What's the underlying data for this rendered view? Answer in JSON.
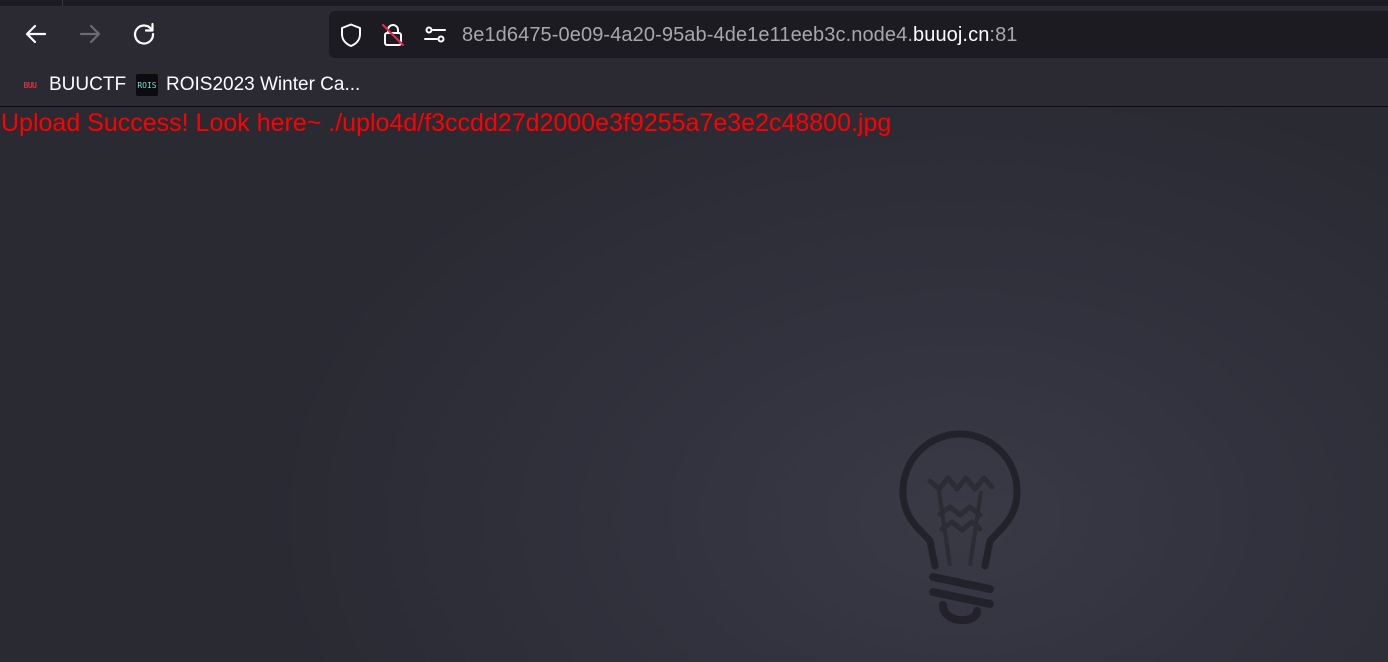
{
  "browser": {
    "toolbar": {
      "back_icon": "arrow-left-icon",
      "forward_icon": "arrow-right-icon",
      "reload_icon": "reload-icon"
    },
    "urlbar": {
      "url_prefix": "8e1d6475-0e09-4a20-95ab-4de1e11eeb3c.node4.",
      "url_domain": "buuoj.cn",
      "url_suffix": ":81",
      "icons": [
        "shield-icon",
        "insecure-lock-icon",
        "permissions-icon"
      ]
    },
    "bookmarks": [
      {
        "label": "BUUCTF",
        "favicon_text": "BUU"
      },
      {
        "label": "ROIS2023 Winter Ca...",
        "favicon_text": "ROIS"
      }
    ]
  },
  "page": {
    "message": "Upload Success! Look here~ ./uplo4d/f3ccdd27d2000e3f9255a7e3e2c48800.jpg",
    "message_color": "#ff0000",
    "background_icon": "lightbulb-icon"
  }
}
